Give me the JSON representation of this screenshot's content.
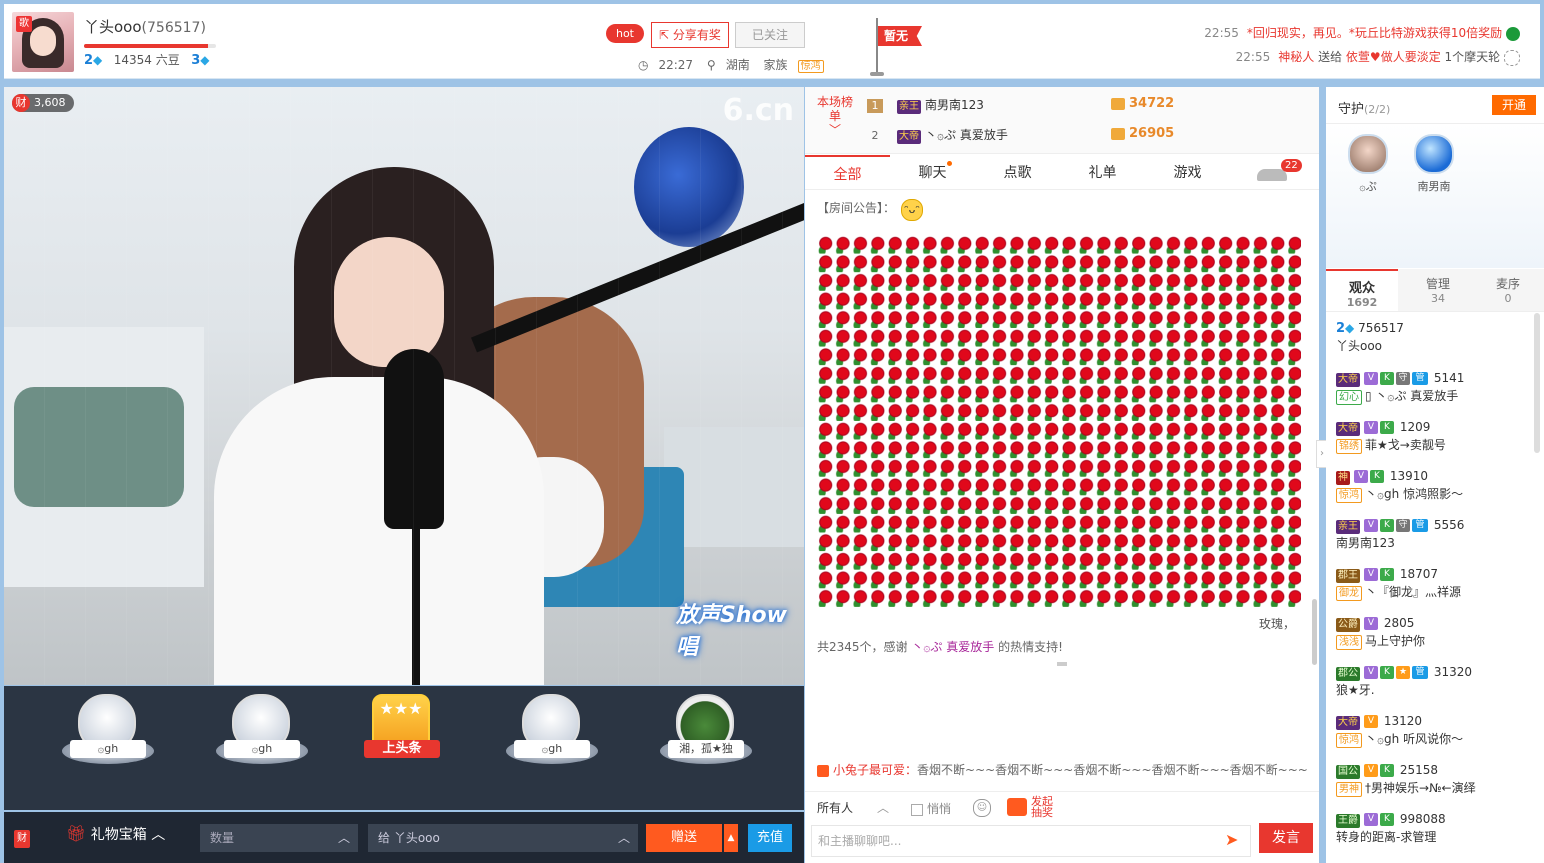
{
  "header": {
    "anchor_name": "丫头ooo",
    "room_id": "(756517)",
    "logo_badge": "歌",
    "wealth_level": "2",
    "beans": "14354 六豆",
    "star_level": "3",
    "level_progress": 0.94,
    "hot": "hot",
    "share": "分享有奖",
    "follow": "已关注",
    "time": "22:27",
    "location": "湖南",
    "family_label": "家族",
    "family_tag": "惊鸿",
    "flag": "暂无"
  },
  "ticker": [
    {
      "time": "22:55",
      "text": "*回归现实，再见。*玩丘比特游戏获得10倍奖励"
    },
    {
      "time": "22:55",
      "sender": "神秘人",
      "verb": "送给",
      "receiver": "依萱",
      "gift": "做人要淡定",
      "count": "1个摩天轮"
    }
  ],
  "video": {
    "fortune": "3,608",
    "watermark": "6.cn",
    "show_logo": "放声Show唱"
  },
  "seats": [
    {
      "nick": "۞gh"
    },
    {
      "nick": "۞gh"
    },
    {
      "nick": "上头条"
    },
    {
      "nick": "۞gh"
    },
    {
      "nick": "湘，孤★独"
    }
  ],
  "bottombar": {
    "badge": "财",
    "gift_box": "礼物宝箱",
    "qty_placeholder": "数量",
    "to_label": "给  丫头ooo",
    "send": "赠送",
    "recharge": "充值"
  },
  "rank": {
    "label": "本场榜单",
    "rows": [
      {
        "num": "1",
        "badge": "亲王",
        "name": "南男南123",
        "score": "34722"
      },
      {
        "num": "2",
        "badge": "大帝",
        "name": "丶۞ぷ 真爱放手",
        "score": "26905"
      }
    ]
  },
  "tabs": [
    {
      "label": "全部"
    },
    {
      "label": "聊天"
    },
    {
      "label": "点歌"
    },
    {
      "label": "礼单"
    },
    {
      "label": "游戏"
    }
  ],
  "car_count": "22",
  "chat": {
    "notice": "【房间公告】：",
    "roses_tail": "玫瑰，",
    "thanks_pre": "共2345个，感谢",
    "thanks_name": "丶۞ぷ 真爱放手",
    "thanks_post": "的热情支持!",
    "rabbit_name": "小兔子最可爱：",
    "rabbit_text": "香烟不断~~~香烟不断~~~香烟不断~~~香烟不断~~~香烟不断~~~"
  },
  "input": {
    "to_all": "所有人",
    "whisper": "悄悄",
    "lottery_1": "发起",
    "lottery_2": "抽奖",
    "placeholder": "和主播聊聊吧...",
    "send": "发言"
  },
  "guard": {
    "title": "守护",
    "count": "(2/2)",
    "open": "开通",
    "members": [
      {
        "name": "۞ぷ"
      },
      {
        "name": "南男南"
      }
    ]
  },
  "audience_tabs": [
    {
      "label": "观众",
      "count": "1692"
    },
    {
      "label": "管理",
      "count": "34"
    },
    {
      "label": "麦序",
      "count": "0"
    }
  ],
  "audience": [
    {
      "level": "2",
      "id": "756517",
      "name": "丫头ooo"
    },
    {
      "badge": "大帝",
      "score": "5141",
      "fam": "幻心",
      "name": "丶۞ぷ 真爱放手"
    },
    {
      "badge": "大帝",
      "score": "1209",
      "fam": "锦绣",
      "name": "菲★戈→卖靓号"
    },
    {
      "badge": "神",
      "score": "13910",
      "fam": "惊鸿",
      "name": "丶۞gh 惊鸿照影～"
    },
    {
      "badge": "亲王",
      "score": "5556",
      "name": "南男南123"
    },
    {
      "badge": "郡王",
      "score": "18707",
      "fam": "御龙",
      "name": "丶『御龙』灬祥源"
    },
    {
      "badge": "公爵",
      "score": "2805",
      "fam": "浅浅",
      "name": "马上守护你"
    },
    {
      "badge": "郡公",
      "score": "31320",
      "name": "狼★牙."
    },
    {
      "badge": "大帝",
      "score": "13120",
      "fam": "惊鸿",
      "name": "丶۞gh 听风说你～"
    },
    {
      "badge": "国公",
      "score": "25158",
      "fam": "男神",
      "name": "†男神娱乐→№←演绎"
    },
    {
      "badge": "王爵",
      "score": "998088",
      "name": "转身的距离-求管理"
    }
  ]
}
